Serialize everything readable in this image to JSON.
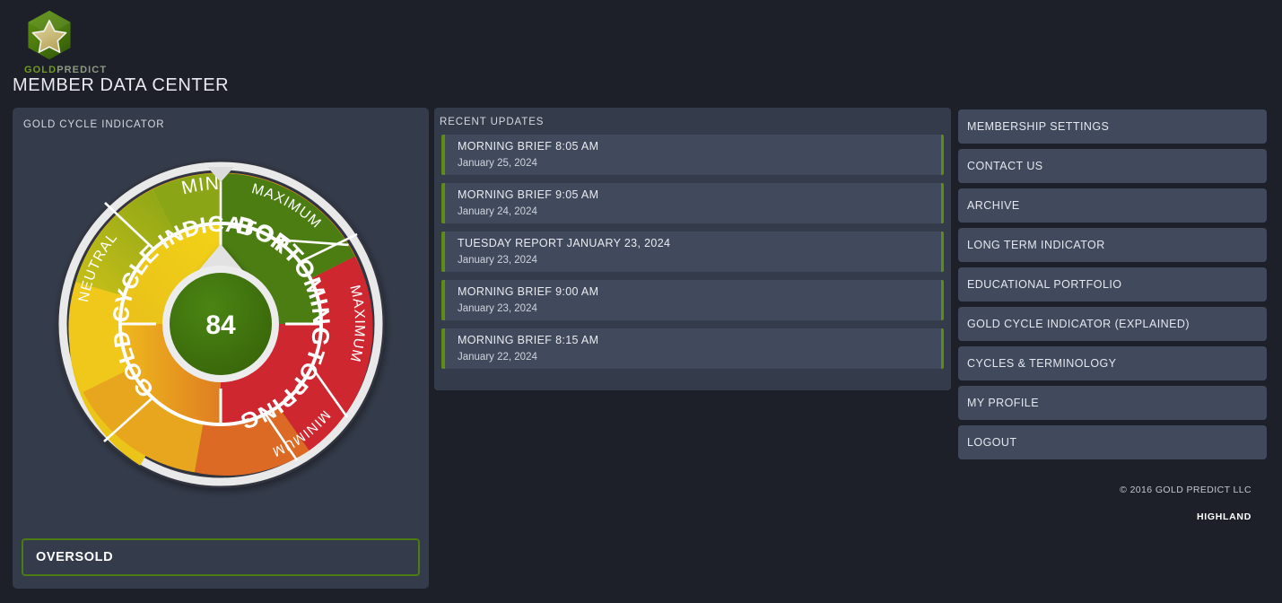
{
  "brand": {
    "part1": "GOLD",
    "part2": "PREDICT",
    "logo_icon": "hexagon-star-icon"
  },
  "header": {
    "title": "MEMBER DATA CENTER"
  },
  "gauge_panel": {
    "heading": "GOLD CYCLE INDICATOR",
    "status": "OVERSOLD"
  },
  "chart_data": {
    "type": "gauge",
    "title": "GOLD CYCLE INDICATOR",
    "value": 84,
    "value_label": "84",
    "range": [
      0,
      100
    ],
    "status": "OVERSOLD",
    "ring_label": "GOLD CYCLE INDICATOR",
    "needle_angle_deg": 0,
    "inner_segments": [
      {
        "label": "BOTTOMING",
        "color": "#4b7d13",
        "start_deg": 0,
        "end_deg": 90
      },
      {
        "label": "TOPPING",
        "color": "#cf2730",
        "start_deg": 90,
        "end_deg": 180
      },
      {
        "label": "",
        "color": "#e4a61d",
        "start_deg": 180,
        "end_deg": 270
      },
      {
        "label": "",
        "color": "#efc81c",
        "start_deg": 270,
        "end_deg": 360
      }
    ],
    "outer_segments": [
      {
        "label": "MINIMUM",
        "color": "#86a818",
        "start_deg": -27,
        "end_deg": 0
      },
      {
        "label": "MAXIMUM",
        "color": "#4b7d13",
        "start_deg": 0,
        "end_deg": 63
      },
      {
        "label": "MAXIMUM",
        "color": "#cf2730",
        "start_deg": 63,
        "end_deg": 126
      },
      {
        "label": "MINIMUM",
        "color": "#dd6a24",
        "start_deg": 126,
        "end_deg": 170
      },
      {
        "label": "NEUTRAL",
        "color": "#efc81c",
        "start_deg": 170,
        "end_deg": 333
      }
    ],
    "colors": {
      "bottoming": "#4b7d13",
      "topping": "#cf2730",
      "neutral_yellow": "#efc81c",
      "orange": "#e08a1e",
      "olive": "#86a818",
      "hub": "#3e7110",
      "ring_white": "#e8e8e8",
      "ring_dark": "#33363f"
    }
  },
  "updates_panel": {
    "heading": "RECENT UPDATES",
    "items": [
      {
        "title": "MORNING BRIEF 8:05 AM",
        "date": "January 25, 2024"
      },
      {
        "title": "MORNING BRIEF 9:05 AM",
        "date": "January 24, 2024"
      },
      {
        "title": "TUESDAY REPORT JANUARY 23, 2024",
        "date": "January 23, 2024"
      },
      {
        "title": "MORNING BRIEF 9:00 AM",
        "date": "January 23, 2024"
      },
      {
        "title": "MORNING BRIEF 8:15 AM",
        "date": "January 22, 2024"
      }
    ]
  },
  "menu": {
    "items": [
      {
        "label": "MEMBERSHIP SETTINGS"
      },
      {
        "label": "CONTACT US"
      },
      {
        "label": "ARCHIVE"
      },
      {
        "label": "LONG TERM INDICATOR"
      },
      {
        "label": "EDUCATIONAL PORTFOLIO"
      },
      {
        "label": "GOLD CYCLE INDICATOR (EXPLAINED)"
      },
      {
        "label": "CYCLES & TERMINOLOGY"
      },
      {
        "label": "MY PROFILE"
      },
      {
        "label": "LOGOUT"
      }
    ]
  },
  "footer": {
    "copyright": "© 2016 GOLD PREDICT LLC",
    "provider": "HIGHLAND"
  }
}
